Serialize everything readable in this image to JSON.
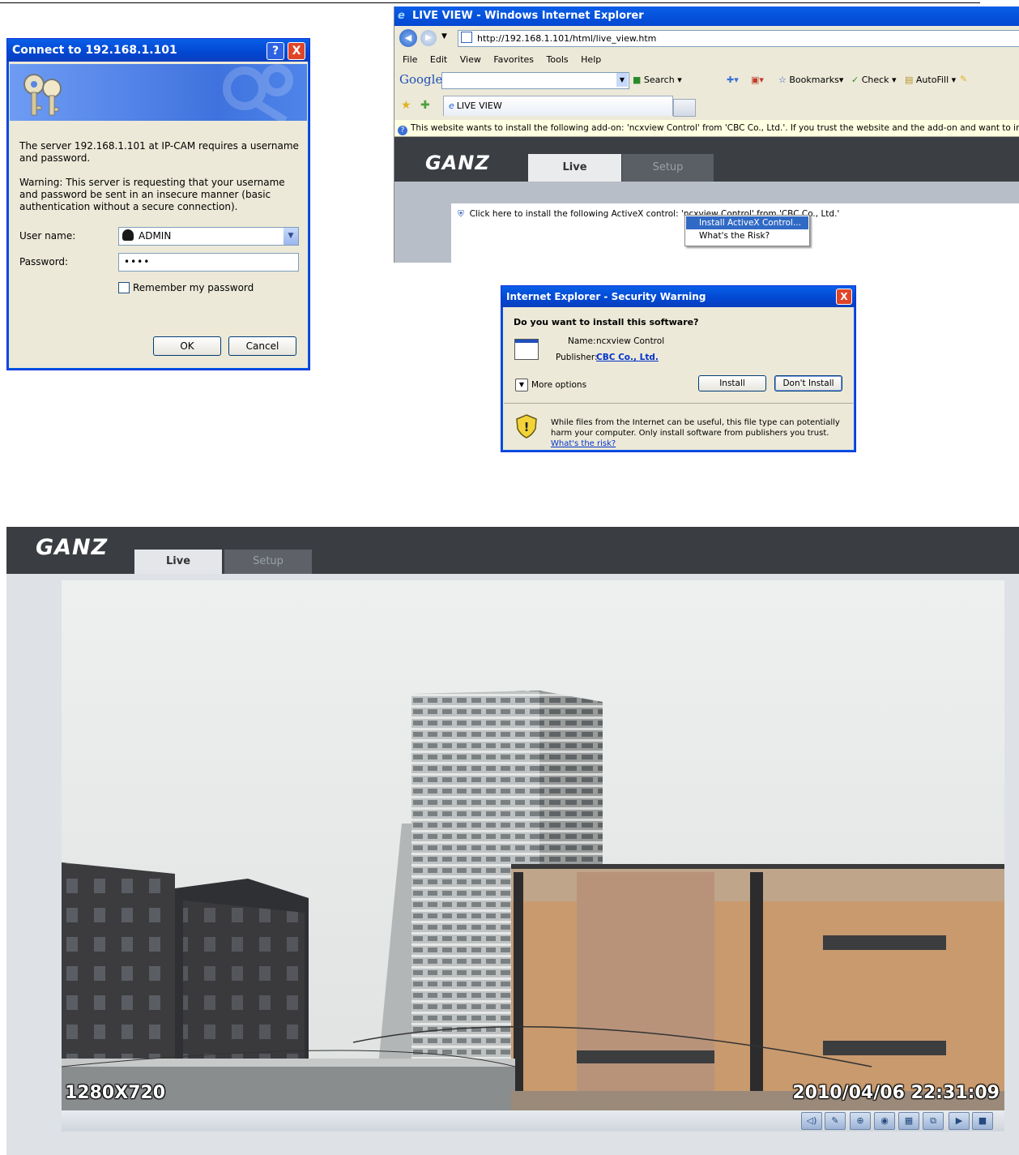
{
  "login": {
    "title": "Connect to 192.168.1.101",
    "help": "?",
    "close": "X",
    "message": "The server 192.168.1.101 at IP-CAM requires a username and password.",
    "warning": "Warning: This server is requesting that your username and password be sent in an insecure manner (basic authentication without a secure connection).",
    "username_label": "User name:",
    "username_value": "ADMIN",
    "password_label": "Password:",
    "password_value": "••••",
    "remember_label": "Remember my password",
    "ok": "OK",
    "cancel": "Cancel"
  },
  "ie": {
    "title": "LIVE VIEW - Windows Internet Explorer",
    "url": "http://192.168.1.101/html/live_view.htm",
    "menu": [
      "File",
      "Edit",
      "View",
      "Favorites",
      "Tools",
      "Help"
    ],
    "google": "Google",
    "search": "Search",
    "bookmarks": "Bookmarks",
    "check": "Check",
    "autofill": "AutoFill",
    "tab": "LIVE VIEW",
    "infobar": "This website wants to install the following add-on: 'ncxview Control' from 'CBC Co., Ltd.'. If you trust the website and the add-on and want to install it, click here...",
    "logo": "GANZ",
    "tab_live": "Live",
    "tab_setup": "Setup",
    "activex_msg": "Click here to install the following ActiveX control: 'ncxview Control' from 'CBC Co., Ltd.'",
    "ctx_install": "Install ActiveX Control...",
    "ctx_risk": "What's the Risk?"
  },
  "security": {
    "title": "Internet Explorer - Security Warning",
    "question": "Do you want to install this software?",
    "name_label": "Name:",
    "name_value": "ncxview Control",
    "publisher_label": "Publisher:",
    "publisher_value": "CBC Co., Ltd.",
    "more_options": "More options",
    "install": "Install",
    "dont_install": "Don't Install",
    "footer": "While files from the Internet can be useful, this file type can potentially harm your computer. Only install software from publishers you trust.",
    "whats_risk": "What's the risk?"
  },
  "live": {
    "logo": "GANZ",
    "tab_live": "Live",
    "tab_setup": "Setup",
    "resolution": "1280X720",
    "timestamp": "2010/04/06 22:31:09",
    "controls": [
      "speaker-icon",
      "microphone-icon",
      "zoom-icon",
      "snapshot-icon",
      "record-icon",
      "fullscreen-icon",
      "play-icon",
      "stop-icon"
    ]
  }
}
